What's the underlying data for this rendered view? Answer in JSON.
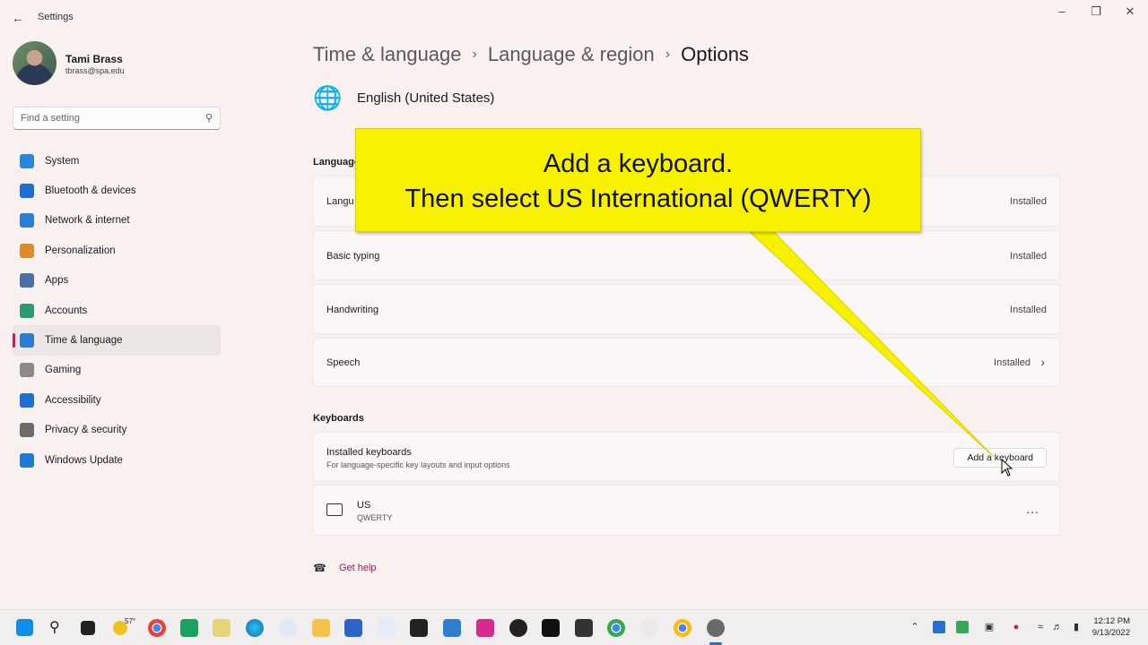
{
  "window": {
    "title": "Settings",
    "back_icon": "back-arrow-icon"
  },
  "profile": {
    "name": "Tami Brass",
    "email": "tbrass@spa.edu"
  },
  "search": {
    "placeholder": "Find a setting"
  },
  "sidebar": {
    "items": [
      {
        "label": "System",
        "icon": "monitor-icon",
        "color": "#2b88d8"
      },
      {
        "label": "Bluetooth & devices",
        "icon": "bluetooth-icon",
        "color": "#1f6fd0"
      },
      {
        "label": "Network & internet",
        "icon": "wifi-icon",
        "color": "#2d7fd6"
      },
      {
        "label": "Personalization",
        "icon": "brush-icon",
        "color": "#e08a2e"
      },
      {
        "label": "Apps",
        "icon": "apps-icon",
        "color": "#4a6fa5"
      },
      {
        "label": "Accounts",
        "icon": "person-icon",
        "color": "#2e9a6b"
      },
      {
        "label": "Time & language",
        "icon": "globe-clock-icon",
        "color": "#2b7cd3"
      },
      {
        "label": "Gaming",
        "icon": "controller-icon",
        "color": "#8a8a8a"
      },
      {
        "label": "Accessibility",
        "icon": "accessibility-icon",
        "color": "#1f6fd0"
      },
      {
        "label": "Privacy & security",
        "icon": "shield-icon",
        "color": "#6b6b6b"
      },
      {
        "label": "Windows Update",
        "icon": "update-icon",
        "color": "#1f7ad6"
      }
    ],
    "active_index": 6,
    "accent": "#c21f5a"
  },
  "breadcrumb": {
    "items": [
      "Time & language",
      "Language & region",
      "Options"
    ]
  },
  "language": {
    "name": "English (United States)"
  },
  "language_features": {
    "section_label": "Language",
    "rows": [
      {
        "title": "Langu",
        "status": "Installed"
      },
      {
        "title": "Basic typing",
        "status": "Installed"
      },
      {
        "title": "Handwriting",
        "status": "Installed"
      },
      {
        "title": "Speech",
        "status": "Installed"
      }
    ]
  },
  "keyboards": {
    "section_label": "Keyboards",
    "installed_title": "Installed keyboards",
    "installed_sub": "For language-specific key layouts and input options",
    "add_button": "Add a keyboard",
    "list": [
      {
        "name": "US",
        "layout": "QWERTY"
      }
    ],
    "more_label": "..."
  },
  "help": {
    "label": "Get help"
  },
  "callout": {
    "line1": "Add a keyboard.",
    "line2": "Then select US International (QWERTY)",
    "color": "#f7f100"
  },
  "taskbar": {
    "weather": "57°",
    "time": "12:12 PM",
    "date": "9/13/2022"
  }
}
